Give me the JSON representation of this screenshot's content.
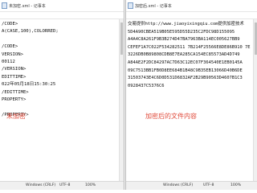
{
  "left_window": {
    "title": "未加密.xml - 记事本",
    "lines": [
      "/CODE>",
      "A(CASE,100),COLORRED;",
      "",
      "/CODE>",
      "VERSION>",
      "00112",
      "/VERSION>",
      "EDITTIME>",
      "022年05月18日15:30:25",
      "/EDITTIME>",
      "PROPERTY>",
      "",
      "/PROPERTY>"
    ],
    "annotation": "未加密",
    "status": {
      "line_ending": "Windows (CRLF)",
      "encoding": "UTF-8",
      "zoom": "100%"
    }
  },
  "right_window": {
    "title": "加密后.xml - 记事本",
    "lines": [
      "交易提供http://www.jiaoyixingqiu.com提供加密技术",
      "5D4A90CBEA519B05E595D55D235C2FDC98D155095",
      "A4A4C8A261F9B3B274D47BA7963BA114EC005627BB9",
      "CEFEF1A7C022F534282511 7B214F25566E8DE86B910 7E",
      "3226DB0B89808CDB8E7EA285CA154EC85573AD4D749",
      "A84AE2F2DC84297AC7D63C12EC07F364540E1EB0145A",
      "09C7513BB1FB0D8EE684B1B48C9B35EB13066D40B6DE",
      "31503743E4C6D0D531D6832AF2B29B90563D4607B1C3",
      "0928437C5376C6"
    ],
    "annotation": "加密后的文件内容",
    "status": {
      "line_ending": "Windows (CRLF)",
      "encoding": "UTF-8",
      "zoom": "100%"
    }
  }
}
